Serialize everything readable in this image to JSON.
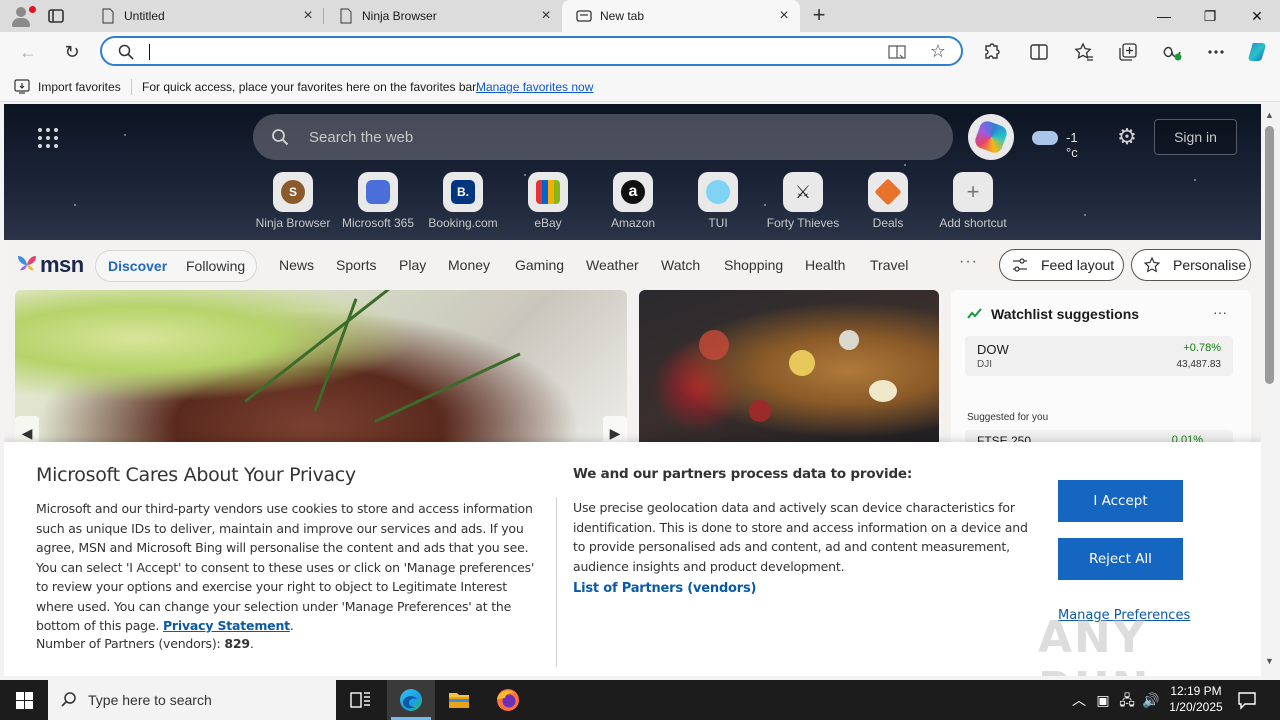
{
  "browser": {
    "tabs": [
      {
        "title": "Untitled"
      },
      {
        "title": "Ninja Browser"
      },
      {
        "title": "New tab"
      }
    ],
    "window_controls": {
      "minimize": "—",
      "restore": "❐",
      "close": "✕"
    },
    "address_bar": {
      "value": "",
      "placeholder": ""
    },
    "favorites_bar": {
      "import_label": "Import favorites",
      "hint": "For quick access, place your favorites here on the favorites bar.",
      "manage_link": "Manage favorites now"
    }
  },
  "newtab": {
    "search_placeholder": "Search the web",
    "weather": {
      "temp": "-1 °c"
    },
    "signin_label": "Sign in",
    "shortcuts": [
      {
        "label": "Ninja Browser",
        "glyph": "S",
        "color": "#8a5a2b"
      },
      {
        "label": "Microsoft 365",
        "glyph": "",
        "color": "#4a6fd8"
      },
      {
        "label": "Booking.com",
        "glyph": "B.",
        "color": "#003580"
      },
      {
        "label": "eBay",
        "glyph": "",
        "color": "#e53238"
      },
      {
        "label": "Amazon",
        "glyph": "a",
        "color": "#111111"
      },
      {
        "label": "TUI",
        "glyph": "",
        "color": "#7fd3f5"
      },
      {
        "label": "Forty Thieves",
        "glyph": "",
        "color": "#222222"
      },
      {
        "label": "Deals",
        "glyph": "",
        "color": "#e8722a"
      },
      {
        "label": "Add shortcut",
        "glyph": "+",
        "color": "#9a9a9a"
      }
    ],
    "msn": {
      "logo": "msn",
      "pill_discover": "Discover",
      "pill_following": "Following",
      "nav": [
        "News",
        "Sports",
        "Play",
        "Money",
        "Gaming",
        "Weather",
        "Watch",
        "Shopping",
        "Health",
        "Travel"
      ],
      "more": "···",
      "feed_layout": "Feed layout",
      "personalise": "Personalise"
    },
    "watchlist": {
      "title": "Watchlist suggestions",
      "more": "···",
      "items": [
        {
          "symbol": "DOW",
          "name": "DJI",
          "change": "+0.78%",
          "price": "43,487.83"
        }
      ],
      "suggested_label": "Suggested for you",
      "suggested": [
        {
          "symbol": "FTSE 250",
          "change": "0.01%"
        }
      ]
    }
  },
  "privacy": {
    "title": "Microsoft Cares About Your Privacy",
    "body": "Microsoft and our third-party vendors use cookies to store and access information such as unique IDs to deliver, maintain and improve our services and ads. If you agree, MSN and Microsoft Bing will personalise the content and ads that you see. You can select 'I Accept' to consent to these uses or click on 'Manage preferences' to review your options and exercise your right to object to Legitimate Interest where used.  You can change your selection under 'Manage Preferences' at the bottom of this page.",
    "privacy_link": "Privacy Statement",
    "partners_count_label": "Number of Partners (vendors):",
    "partners_count": "829",
    "process_title": "We and our partners process data to provide:",
    "process_body": "Use precise geolocation data and actively scan device characteristics for identification. This is done to store and access information on a device and to provide personalised ads and content, ad and content measurement, audience insights and product development.",
    "partners_link": "List of Partners (vendors)",
    "accept_label": "I Accept",
    "reject_label": "Reject All",
    "manage_label": "Manage Preferences"
  },
  "watermark": "ANY RUN",
  "taskbar": {
    "search_placeholder": "Type here to search",
    "time": "12:19 PM",
    "date": "1/20/2025"
  },
  "colors": {
    "accent": "#1566c0",
    "link": "#0b5aa8",
    "omnibox_focus": "#2f7fd1",
    "positive": "#0f7b0f"
  }
}
